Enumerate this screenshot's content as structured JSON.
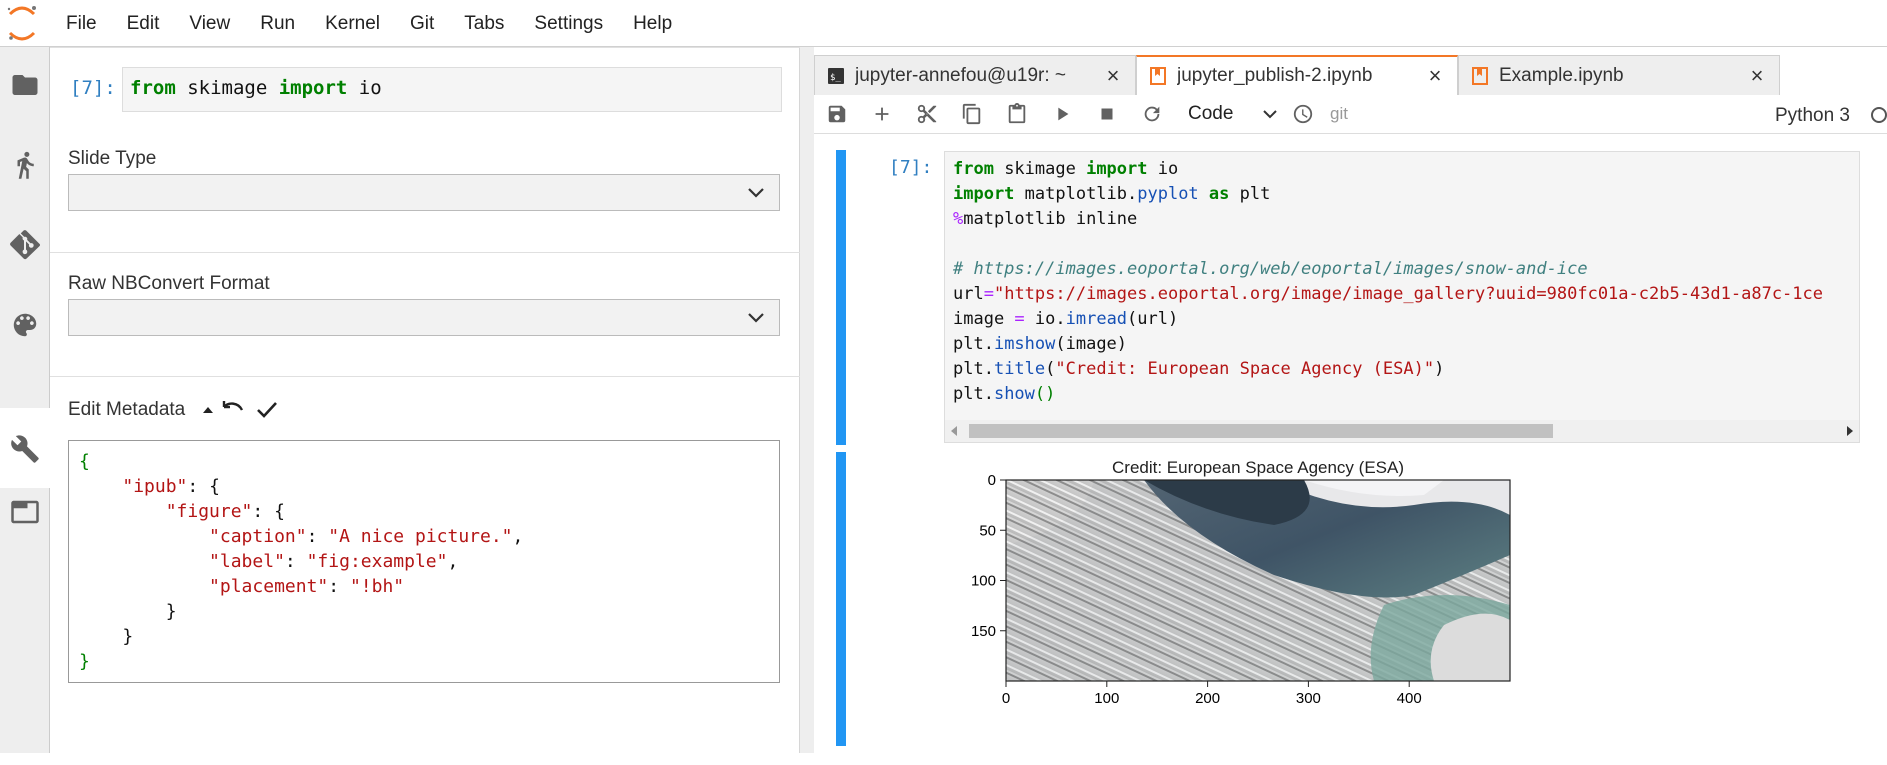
{
  "menubar": {
    "items": [
      "File",
      "Edit",
      "View",
      "Run",
      "Kernel",
      "Git",
      "Tabs",
      "Settings",
      "Help"
    ]
  },
  "left_sidebar": {
    "icons": [
      "folder-icon",
      "running-icon",
      "git-icon",
      "palette-icon",
      "wrench-icon",
      "tabs-icon"
    ],
    "active": "wrench-icon"
  },
  "property_inspector": {
    "cell_prompt": "[7]:",
    "cell_code": {
      "kw1": "from",
      "mod": " skimage ",
      "kw2": "import",
      "name": " io"
    },
    "slide_type_label": "Slide Type",
    "slide_type_value": "",
    "raw_format_label": "Raw NBConvert Format",
    "raw_format_value": "",
    "edit_metadata_label": "Edit Metadata",
    "metadata": {
      "l1": "{",
      "l2_key": "\"ipub\"",
      "l2_rest": ": {",
      "l3_key": "\"figure\"",
      "l3_rest": ": {",
      "l4_key": "\"caption\"",
      "l4_val": "\"A nice picture.\"",
      "l5_key": "\"label\"",
      "l5_val": "\"fig:example\"",
      "l6_key": "\"placement\"",
      "l6_val": "\"!bh\"",
      "l7": "}",
      "l8": "}",
      "l9": "}"
    }
  },
  "tabs": [
    {
      "label": "jupyter-annefou@u19r: ~",
      "icon": "terminal-icon",
      "active": false
    },
    {
      "label": "jupyter_publish-2.ipynb",
      "icon": "notebook-icon",
      "active": true
    },
    {
      "label": "Example.ipynb",
      "icon": "notebook-icon",
      "active": false
    }
  ],
  "toolbar": {
    "cell_type": "Code",
    "git_label": "git",
    "kernel_name": "Python 3"
  },
  "notebook": {
    "prompt": "[7]:",
    "code": {
      "l1a": "from",
      "l1b": " skimage ",
      "l1c": "import",
      "l1d": " io",
      "l2a": "import",
      "l2b": " matplotlib.",
      "l2c": "pyplot",
      "l2d": " ",
      "l2e": "as",
      "l2f": " plt",
      "l3a": "%",
      "l3b": "matplotlib inline",
      "l5": "# https://images.eoportal.org/web/eoportal/images/snow-and-ice",
      "l6a": "url",
      "l6b": "=",
      "l6c": "\"https://images.eoportal.org/image/image_gallery?uuid=980fc01a-c2b5-43d1-a87c-1ce",
      "l7a": "image ",
      "l7b": "=",
      "l7c": " io.",
      "l7d": "imread",
      "l7e": "(url)",
      "l8a": "plt.",
      "l8b": "imshow",
      "l8c": "(image)",
      "l9a": "plt.",
      "l9b": "title",
      "l9c": "(",
      "l9d": "\"Credit: European Space Agency (ESA)\"",
      "l9e": ")",
      "l10a": "plt.",
      "l10b": "show",
      "l10c": "()"
    }
  },
  "chart_data": {
    "type": "image",
    "title": "Credit: European Space Agency (ESA)",
    "x_ticks": [
      0,
      100,
      200,
      300,
      400
    ],
    "y_ticks": [
      0,
      50,
      100,
      150
    ],
    "xlim": [
      0,
      500
    ],
    "ylim": [
      0,
      200
    ],
    "y_inverted": true,
    "content": "satellite image of cloud streets and sea ice"
  }
}
